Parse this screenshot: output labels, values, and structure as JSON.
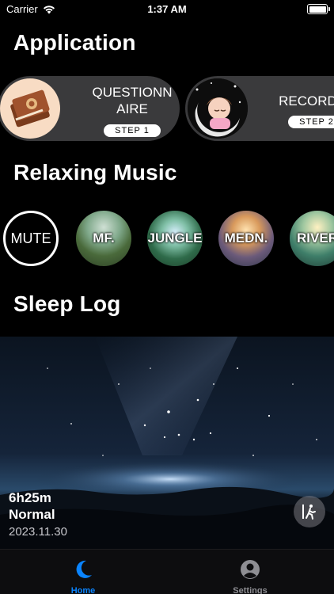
{
  "status_bar": {
    "carrier": "Carrier",
    "time": "1:37 AM"
  },
  "sections": {
    "application": "Application",
    "relaxing_music": "Relaxing Music",
    "sleep_log": "Sleep Log"
  },
  "applications": [
    {
      "label_line1": "QUESTIONN",
      "label_line2": "AIRE",
      "step": "STEP 1"
    },
    {
      "label_line1": "RECORD",
      "step": "STEP 2"
    }
  ],
  "music": [
    {
      "label": "MUTE"
    },
    {
      "label": "MF."
    },
    {
      "label": "JUNGLE"
    },
    {
      "label": "MEDN."
    },
    {
      "label": "RIVER"
    }
  ],
  "sleep_entry": {
    "duration": "6h25m",
    "quality": "Normal",
    "date": "2023.11.30"
  },
  "tabs": [
    {
      "label": "Home",
      "icon": "moon-icon",
      "active": true
    },
    {
      "label": "Settings",
      "icon": "person-circle-icon",
      "active": false
    }
  ],
  "colors": {
    "accent": "#0a84ff",
    "inactive": "#8e8e93",
    "card": "#3a3a3c"
  }
}
